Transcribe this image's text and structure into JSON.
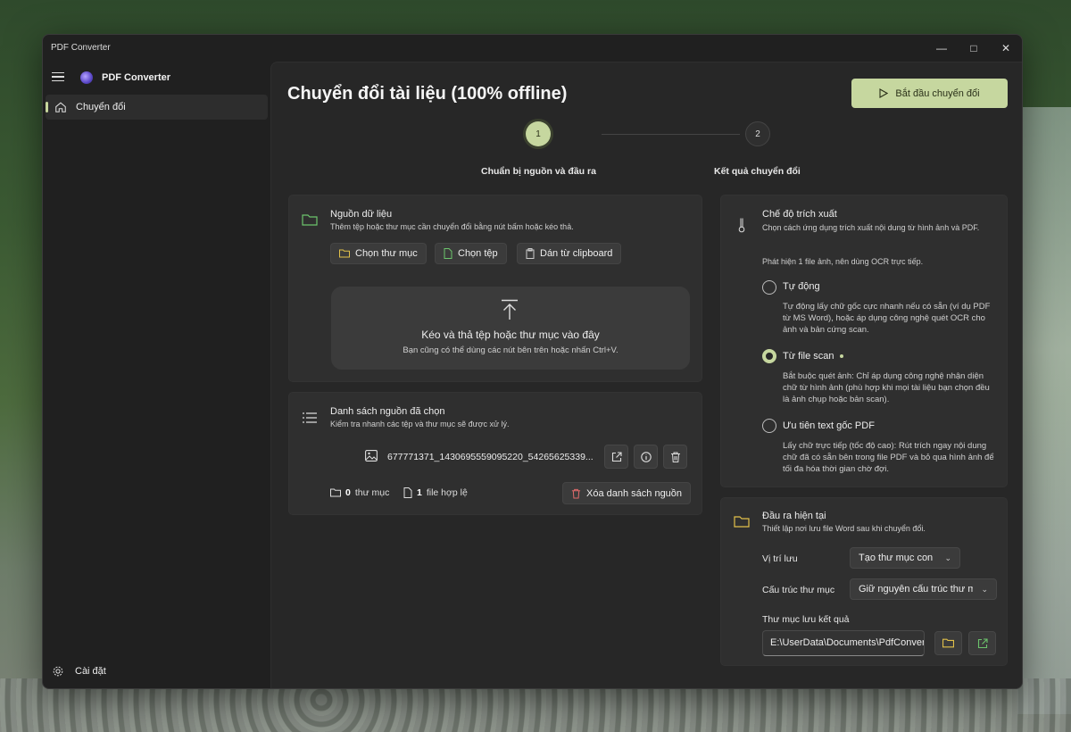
{
  "window": {
    "title": "PDF Converter"
  },
  "sidebar": {
    "app_name": "PDF Converter",
    "nav": [
      {
        "label": "Chuyển đổi",
        "icon": "home-icon"
      }
    ],
    "settings_label": "Cài đặt"
  },
  "header": {
    "title": "Chuyển đổi tài liệu (100% offline)",
    "start_button": "Bắt đầu chuyển đổi"
  },
  "steps": [
    {
      "number": "1",
      "label": "Chuẩn bị nguồn và đầu ra"
    },
    {
      "number": "2",
      "label": "Kết quả chuyển đổi"
    }
  ],
  "source": {
    "title": "Nguồn dữ liệu",
    "subtitle": "Thêm tệp hoặc thư mục cần chuyển đổi bằng nút bấm hoặc kéo thả.",
    "buttons": {
      "choose_folder": "Chọn thư mục",
      "choose_file": "Chọn tệp",
      "paste": "Dán từ clipboard"
    },
    "dropzone": {
      "title": "Kéo và thả tệp hoặc thư mục vào đây",
      "subtitle": "Bạn cũng có thể dùng các nút bên trên hoặc nhấn Ctrl+V."
    }
  },
  "source_list": {
    "title": "Danh sách nguồn đã chọn",
    "subtitle": "Kiểm tra nhanh các tệp và thư mục sẽ được xử lý.",
    "items": [
      {
        "name": "677771371_1430695559095220_54265625339..."
      }
    ],
    "folder_count": "0",
    "folder_label": "thư mục",
    "file_count": "1",
    "file_label": "file hợp lệ",
    "clear_button": "Xóa danh sách nguồn"
  },
  "extraction": {
    "title": "Chế độ trích xuất",
    "subtitle": "Chọn cách ứng dụng trích xuất nội dung từ hình ảnh và PDF.",
    "hint": "Phát hiện 1 file ảnh, nên dùng OCR trực tiếp.",
    "options": [
      {
        "label": "Tự động",
        "desc": "Tự động lấy chữ gốc cực nhanh nếu có sẵn (ví dụ PDF từ MS Word), hoặc áp dụng công nghệ quét OCR cho ảnh và bản cứng scan.",
        "selected": false
      },
      {
        "label": "Từ file scan",
        "desc": "Bắt buộc quét ảnh: Chỉ áp dụng công nghệ nhận diện chữ từ hình ảnh (phù hợp khi mọi tài liệu bạn chọn đều là ảnh chụp hoặc bản scan).",
        "selected": true
      },
      {
        "label": "Ưu tiên text gốc PDF",
        "desc": "Lấy chữ trực tiếp (tốc độ cao): Rút trích ngay nội dung chữ đã có sẵn bên trong file PDF và bỏ qua hình ảnh để tối đa hóa thời gian chờ đợi.",
        "selected": false
      }
    ]
  },
  "output": {
    "title": "Đầu ra hiện tại",
    "subtitle": "Thiết lập nơi lưu file Word sau khi chuyển đổi.",
    "location_label": "Vị trí lưu",
    "location_value": "Tạo thư mục con",
    "structure_label": "Cấu trúc thư mục",
    "structure_value": "Giữ nguyên cấu trúc thư mục",
    "folder_label": "Thư mục lưu kết quả",
    "folder_value": "E:\\UserData\\Documents\\PdfConverter"
  },
  "colors": {
    "accent": "#c6d79f",
    "folder": "#e2c14a",
    "green_icon": "#6cc46c",
    "danger": "#e06b6b"
  }
}
